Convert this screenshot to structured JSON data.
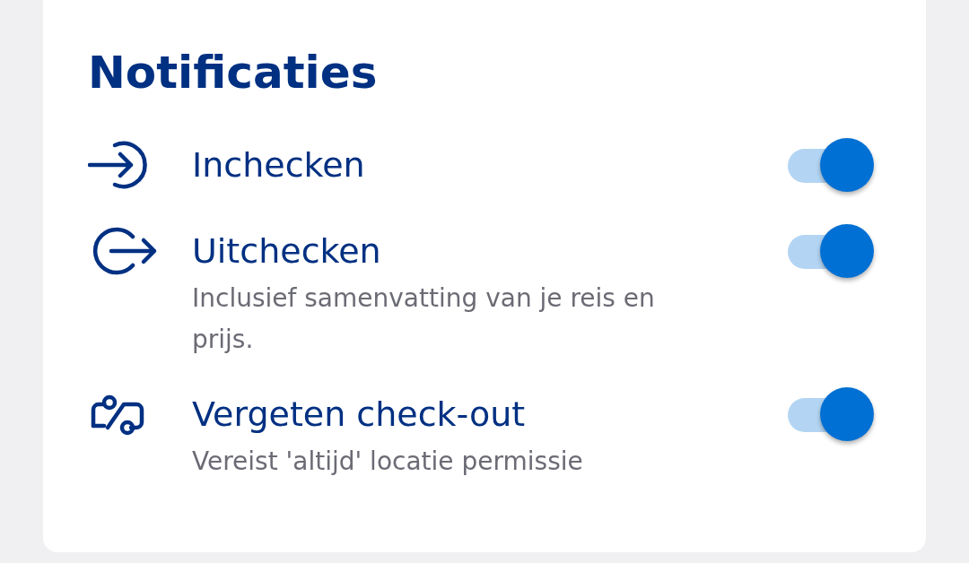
{
  "title": "Notificaties",
  "items": [
    {
      "kind": "checkin",
      "label": "Inchecken",
      "on": true
    },
    {
      "kind": "checkout",
      "label": "Uitchecken",
      "description": "Inclusief samenvatting van je reis en prijs.",
      "on": true
    },
    {
      "kind": "route",
      "label": "Vergeten check-out",
      "description": "Vereist 'altijd' locatie permissie",
      "on": true
    }
  ]
}
